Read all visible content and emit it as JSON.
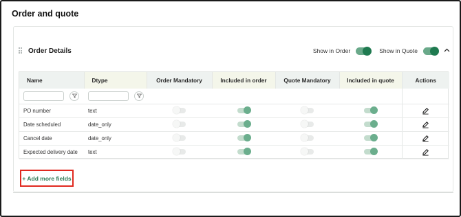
{
  "page": {
    "title": "Order and quote"
  },
  "section": {
    "title": "Order Details",
    "show_in_order_label": "Show in Order",
    "show_in_quote_label": "Show in Quote",
    "show_in_order": true,
    "show_in_quote": true
  },
  "table": {
    "headers": [
      "Name",
      "Dtype",
      "Order Mandatory",
      "Included in order",
      "Quote Mandatory",
      "Included in quote",
      "Actions"
    ],
    "rows": [
      {
        "name": "PO number",
        "dtype": "text",
        "order_mandatory": false,
        "included_in_order": true,
        "quote_mandatory": false,
        "included_in_quote": true
      },
      {
        "name": "Date scheduled",
        "dtype": "date_only",
        "order_mandatory": false,
        "included_in_order": true,
        "quote_mandatory": false,
        "included_in_quote": true
      },
      {
        "name": "Cancel date",
        "dtype": "date_only",
        "order_mandatory": false,
        "included_in_order": true,
        "quote_mandatory": false,
        "included_in_quote": true
      },
      {
        "name": "Expected delivery date",
        "dtype": "text",
        "order_mandatory": false,
        "included_in_order": true,
        "quote_mandatory": false,
        "included_in_quote": true
      }
    ]
  },
  "add_more_label": "+ Add more fields",
  "colors": {
    "accent": "#1f7a50",
    "highlight_border": "#e0291f"
  }
}
